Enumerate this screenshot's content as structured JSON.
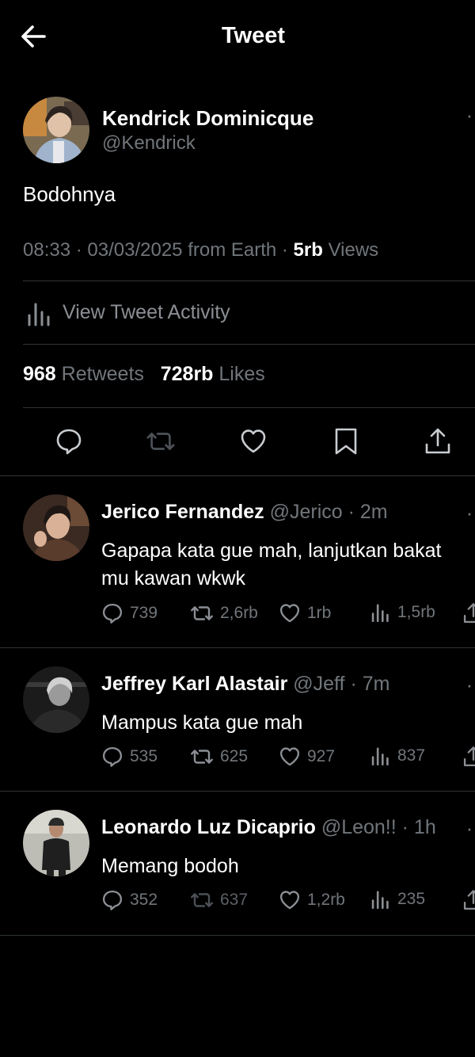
{
  "header": {
    "title": "Tweet"
  },
  "tweet": {
    "author_name": "Kendrick Dominicque",
    "author_handle": "@Kendrick",
    "text": "Bodohnya",
    "time": "08:33",
    "date": "03/03/2025",
    "source": "from Earth",
    "views_count": "5rb",
    "views_label": "Views",
    "activity_label": "View Tweet Activity",
    "retweets_count": "968",
    "retweets_label": "Retweets",
    "likes_count": "728rb",
    "likes_label": "Likes"
  },
  "replies": [
    {
      "name": "Jerico Fernandez",
      "handle": "@Jerico",
      "time": "2m",
      "text": "Gapapa kata gue mah, lanjutkan bakat mu kawan wkwk",
      "replies": "739",
      "retweets": "2,6rb",
      "likes": "1rb",
      "views": "1,5rb"
    },
    {
      "name": "Jeffrey Karl Alastair",
      "handle": "@Jeff",
      "time": "7m",
      "text": "Mampus kata gue mah",
      "replies": "535",
      "retweets": "625",
      "likes": "927",
      "views": "837"
    },
    {
      "name": "Leonardo Luz Dicaprio",
      "handle": "@Leon!!",
      "time": "1h",
      "text": "Memang bodoh",
      "replies": "352",
      "retweets": "637",
      "likes": "1,2rb",
      "views": "235"
    }
  ],
  "colors": {
    "background": "#000000",
    "text": "#e7e9ea",
    "muted": "#71767b",
    "divider": "#2f3336"
  }
}
